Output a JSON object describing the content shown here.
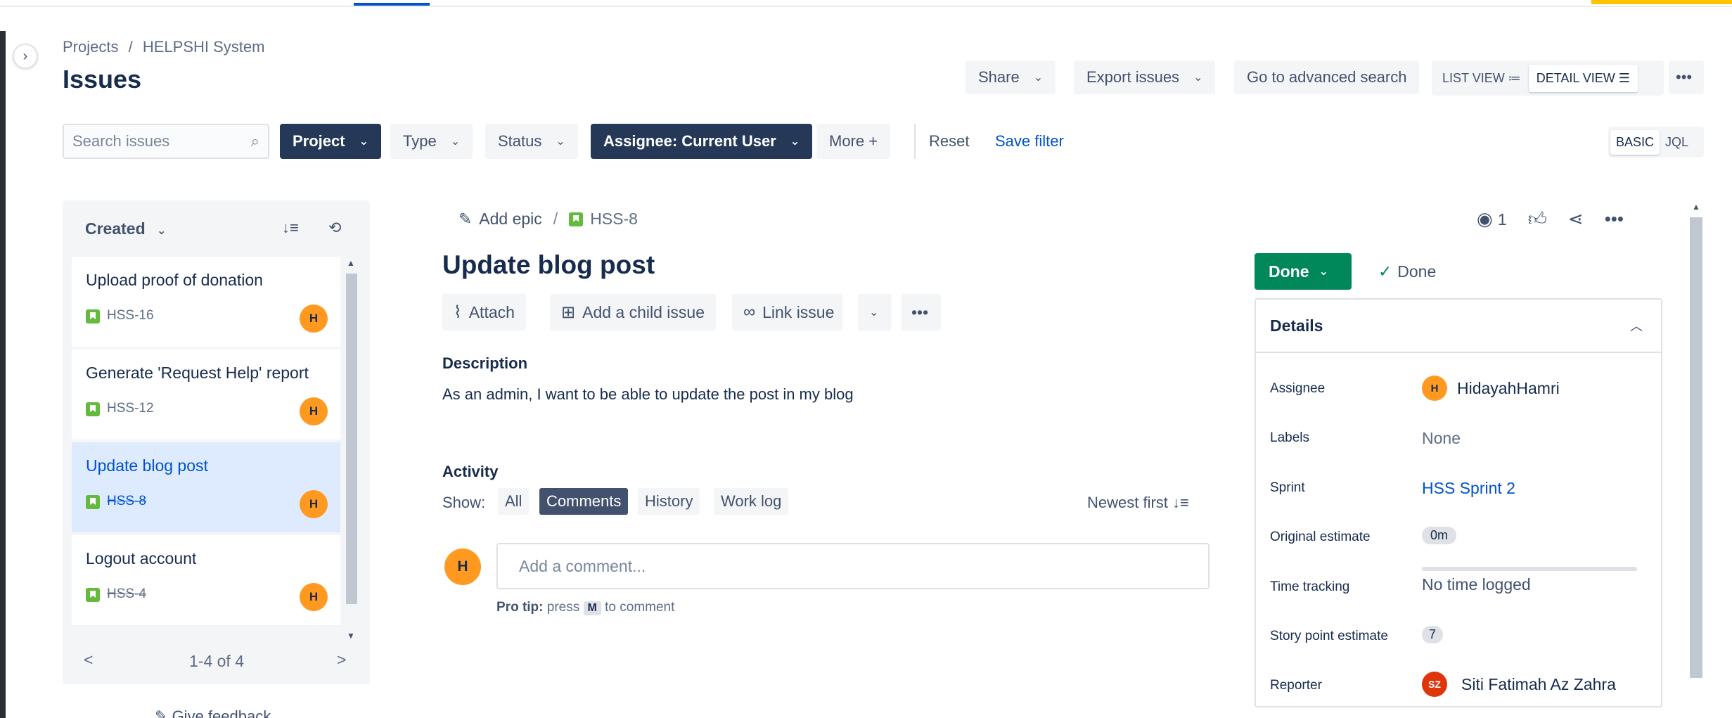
{
  "breadcrumb": {
    "projects": "Projects",
    "sep": "/",
    "project": "HELPSHI System"
  },
  "page": {
    "title": "Issues"
  },
  "header_actions": {
    "share": "Share",
    "export": "Export issues",
    "advanced": "Go to advanced search",
    "list_view": "LIST VIEW",
    "list_view_icon": "≔",
    "detail_view": "DETAIL VIEW",
    "detail_view_icon": "☰",
    "more": "•••"
  },
  "filters": {
    "search_placeholder": "Search issues",
    "project": "Project",
    "type": "Type",
    "status": "Status",
    "assignee": "Assignee: Current User",
    "more": "More +",
    "reset": "Reset",
    "save_filter": "Save filter",
    "mode_basic": "BASIC",
    "mode_jql": "JQL"
  },
  "list": {
    "sort_label": "Created",
    "sort_icon": "↓≡",
    "refresh_icon": "⟲",
    "items": [
      {
        "title": "Upload proof of donation",
        "key": "HSS-16",
        "avatar": "H",
        "done": false,
        "selected": false
      },
      {
        "title": "Generate 'Request Help' report",
        "key": "HSS-12",
        "avatar": "H",
        "done": false,
        "selected": false
      },
      {
        "title": "Update blog post",
        "key": "HSS-8",
        "avatar": "H",
        "done": true,
        "selected": true
      },
      {
        "title": "Logout account",
        "key": "HSS-4",
        "avatar": "H",
        "done": true,
        "selected": false
      }
    ],
    "pager": {
      "prev": "<",
      "count": "1-4 of 4",
      "next": ">"
    },
    "feedback": "Give feedback"
  },
  "issue": {
    "add_epic": "Add epic",
    "sep": "/",
    "key": "HSS-8",
    "title": "Update blog post",
    "actions": {
      "attach": "Attach",
      "child": "Add a child issue",
      "link": "Link issue",
      "more": "•••"
    },
    "description_label": "Description",
    "description": "As an admin, I want to be able to update the post in my blog",
    "activity_label": "Activity",
    "show_label": "Show:",
    "tabs": {
      "all": "All",
      "comments": "Comments",
      "history": "History",
      "worklog": "Work log"
    },
    "newest": "Newest first ↓≡",
    "comment_avatar": "H",
    "comment_placeholder": "Add a comment...",
    "protip_bold": "Pro tip:",
    "protip_press": "press",
    "protip_key": "M",
    "protip_rest": "to comment",
    "watchers": "1"
  },
  "status": {
    "button": "Done",
    "resolution": "Done"
  },
  "details": {
    "header": "Details",
    "assignee_label": "Assignee",
    "assignee_avatar": "H",
    "assignee": "HidayahHamri",
    "labels_label": "Labels",
    "labels": "None",
    "sprint_label": "Sprint",
    "sprint": "HSS Sprint 2",
    "estimate_label": "Original estimate",
    "estimate": "0m",
    "tracking_label": "Time tracking",
    "tracking": "No time logged",
    "points_label": "Story point estimate",
    "points": "7",
    "reporter_label": "Reporter",
    "reporter_avatar": "SZ",
    "reporter": "Siti Fatimah Az Zahra"
  },
  "colors": {
    "primary": "#0052cc",
    "dark_button": "#253858",
    "done": "#00875a",
    "avatar": "#ff991f",
    "reporter_avatar": "#de350b",
    "story": "#63ba3c"
  }
}
